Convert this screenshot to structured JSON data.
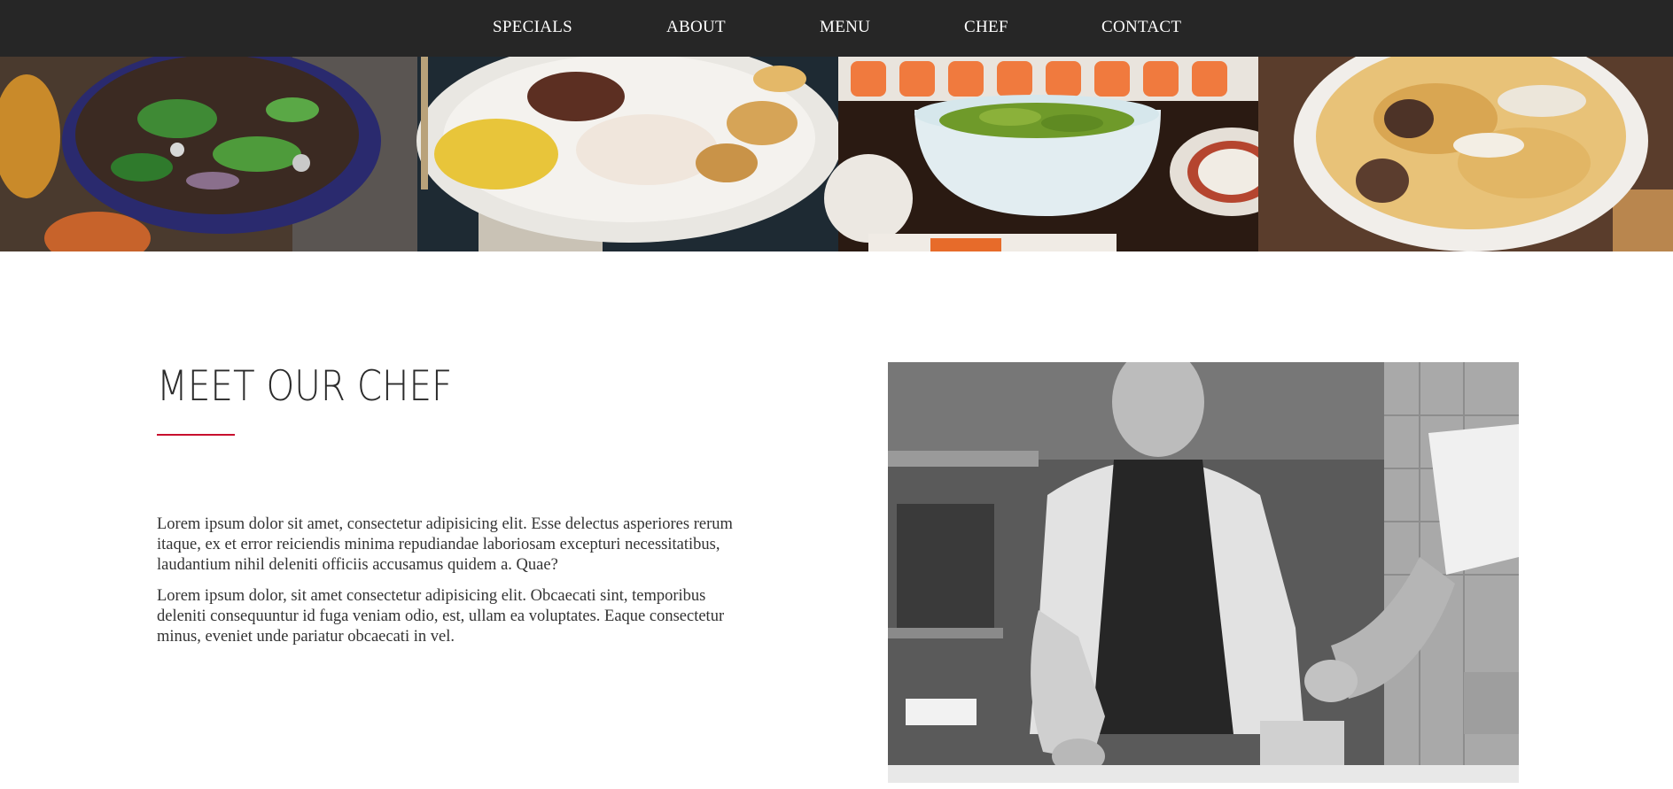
{
  "nav": {
    "items": [
      {
        "label": "SPECIALS"
      },
      {
        "label": "ABOUT"
      },
      {
        "label": "MENU"
      },
      {
        "label": "CHEF"
      },
      {
        "label": "CONTACT"
      }
    ]
  },
  "gallery": {
    "images": [
      {
        "icon": "salad-bowl-photo"
      },
      {
        "icon": "grilled-squid-plate-photo"
      },
      {
        "icon": "sushi-edamame-photo"
      },
      {
        "icon": "pasta-bowl-photo"
      }
    ]
  },
  "chef_section": {
    "title": "MEET OUR CHEF",
    "paragraphs": [
      "Lorem ipsum dolor sit amet, consectetur adipisicing elit. Esse delectus asperiores rerum itaque, ex et error reiciendis minima repudiandae laboriosam excepturi necessitatibus, laudantium nihil deleniti officiis accusamus quidem a. Quae?",
      "Lorem ipsum dolor, sit amet consectetur adipisicing elit. Obcaecati sint, temporibus deleniti consequuntur id fuga veniam odio, est, ullam ea voluptates. Eaque consectetur minus, eveniet unde pariatur obcaecati in vel."
    ],
    "photo": {
      "icon": "chef-cooking-photo"
    }
  },
  "colors": {
    "nav_background": "#262626",
    "nav_text": "#ffffff",
    "accent": "#c8102e",
    "body_text": "#333333"
  }
}
